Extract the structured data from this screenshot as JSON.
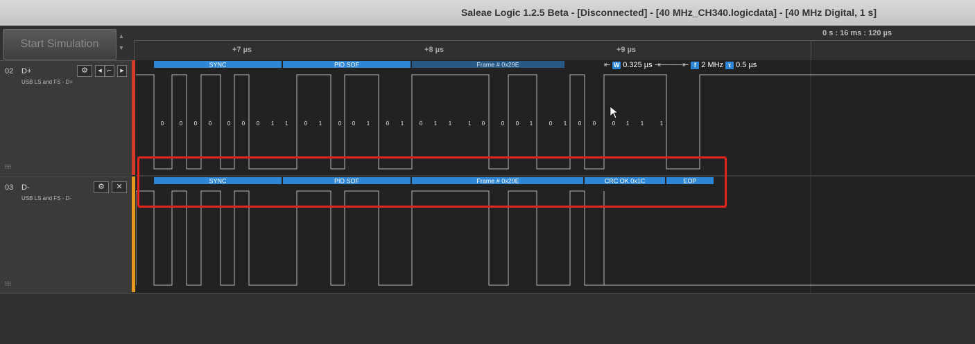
{
  "window": {
    "title": "Saleae Logic 1.2.5 Beta - [Disconnected] - [40 MHz_CH340.logicdata] - [40 MHz Digital, 1 s]"
  },
  "toolbar": {
    "start_simulation": "Start Simulation"
  },
  "timeline": {
    "readout": "0 s : 16 ms : 120 µs",
    "ticks": [
      "+7 µs",
      "+8 µs",
      "+9 µs"
    ]
  },
  "measurements": {
    "width_badge": "W",
    "width": "0.325 µs",
    "freq_badge": "f",
    "frequency": "2 MHz",
    "period_badge": "τ",
    "period": "0.5 µs"
  },
  "channels": [
    {
      "num": "02",
      "name": "D+",
      "analyzer": "USB LS and FS - D+",
      "marker_color": "#d33a2c",
      "protocol": [
        "SYNC",
        "PID SOF",
        "Frame # 0x29E"
      ],
      "bits": [
        "0",
        "0",
        "0",
        "0",
        "0",
        "0",
        "0",
        "1",
        "1",
        "0",
        "1",
        "0",
        "0",
        "1",
        "0",
        "1",
        "0",
        "1",
        "1",
        "1",
        "0",
        "0",
        "0",
        "1",
        "0",
        "1",
        "0",
        "0",
        "0",
        "1",
        "1",
        "1"
      ]
    },
    {
      "num": "03",
      "name": "D-",
      "analyzer": "USB LS and FS - D-",
      "marker_color": "#e39a1e",
      "protocol": [
        "SYNC",
        "PID SOF",
        "Frame # 0x29E",
        "CRC OK 0x1C",
        "EOP"
      ]
    }
  ],
  "colors": {
    "protocol_bar": "#2e86d6",
    "highlight": "#e8241f"
  }
}
